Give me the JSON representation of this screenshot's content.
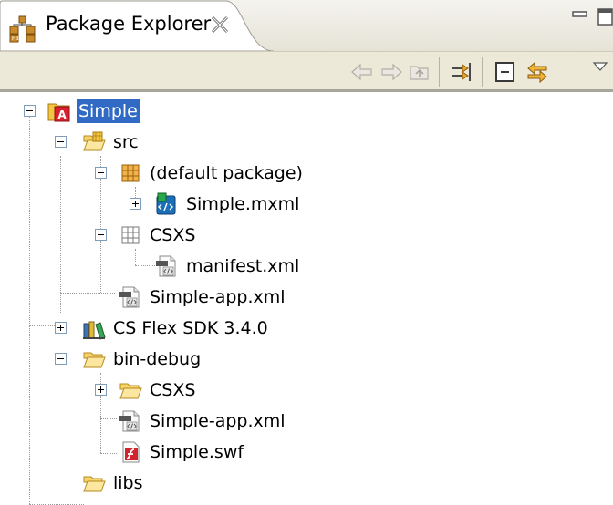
{
  "view": {
    "title": "Package Explorer",
    "tab_icon": "package-explorer-icon",
    "close_icon": "close-icon",
    "minimize_icon": "minimize-icon",
    "maximize_icon": "maximize-icon"
  },
  "toolbar": {
    "buttons": [
      {
        "icon": "back-arrow-icon",
        "enabled": false
      },
      {
        "icon": "forward-arrow-icon",
        "enabled": false
      },
      {
        "icon": "up-folder-icon",
        "enabled": false
      },
      {
        "icon": "filter-icon",
        "enabled": true
      },
      {
        "icon": "collapse-all-icon",
        "enabled": true
      },
      {
        "icon": "link-with-editor-icon",
        "enabled": true
      },
      {
        "icon": "view-menu-icon",
        "enabled": true
      }
    ]
  },
  "tree": {
    "nodes": [
      {
        "label": "Simple",
        "icon": "flex-project-icon",
        "expanded": true,
        "selected": true
      },
      {
        "label": "src",
        "icon": "source-folder-icon",
        "expanded": true
      },
      {
        "label": "(default package)",
        "icon": "package-icon",
        "expanded": true
      },
      {
        "label": "Simple.mxml",
        "icon": "mxml-file-icon",
        "expanded": false
      },
      {
        "label": "CSXS",
        "icon": "empty-package-icon",
        "expanded": true
      },
      {
        "label": "manifest.xml",
        "icon": "xml-file-icon"
      },
      {
        "label": "Simple-app.xml",
        "icon": "xml-file-icon"
      },
      {
        "label": "CS Flex SDK 3.4.0",
        "icon": "library-icon",
        "expanded": false
      },
      {
        "label": "bin-debug",
        "icon": "folder-icon",
        "expanded": true
      },
      {
        "label": "CSXS",
        "icon": "folder-icon",
        "expanded": false
      },
      {
        "label": "Simple-app.xml",
        "icon": "xml-file-icon"
      },
      {
        "label": "Simple.swf",
        "icon": "swf-file-icon"
      },
      {
        "label": "libs",
        "icon": "folder-icon"
      }
    ]
  },
  "colors": {
    "selection": "#316ac5",
    "toolbar_bg": "#ece9d8",
    "tab_bg": "#ffffff"
  }
}
